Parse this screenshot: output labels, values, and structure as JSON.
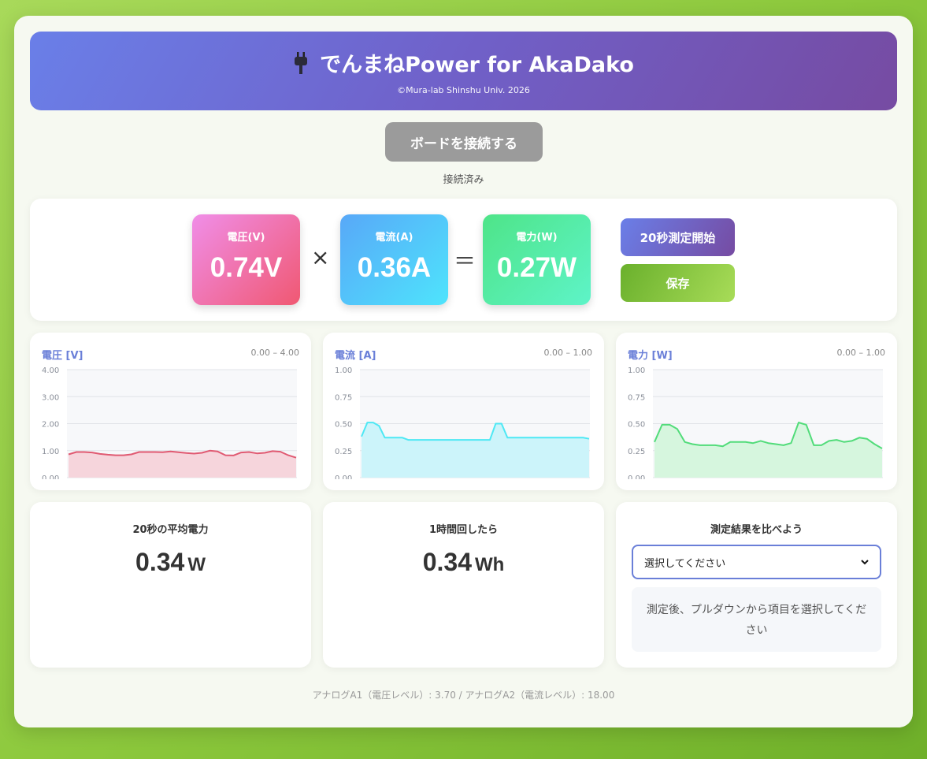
{
  "header": {
    "title": "でんまねPower for AkaDako",
    "subtitle": "©Mura-lab Shinshu Univ. 2026",
    "icon": "plug-icon"
  },
  "connection": {
    "button_label": "ボードを接続する",
    "status": "接続済み"
  },
  "meters": {
    "voltage": {
      "label": "電圧(V)",
      "value": "0.74V"
    },
    "current": {
      "label": "電流(A)",
      "value": "0.36A"
    },
    "power": {
      "label": "電力(W)",
      "value": "0.27W"
    },
    "times": "×",
    "equals": "＝"
  },
  "actions": {
    "start_label": "20秒測定開始",
    "save_label": "保存"
  },
  "charts": {
    "voltage": {
      "title": "電圧 [V]",
      "range": "0.00 – 4.00"
    },
    "current": {
      "title": "電流 [A]",
      "range": "0.00 – 1.00"
    },
    "power": {
      "title": "電力 [W]",
      "range": "0.00 – 1.00"
    }
  },
  "chart_data": [
    {
      "type": "area",
      "title": "電圧 [V]",
      "ylim": [
        0,
        4
      ],
      "yticks": [
        "0.00",
        "1.00",
        "2.00",
        "3.00",
        "4.00"
      ],
      "color": "#e05a72",
      "fill": "#f6d5dc",
      "values": [
        0.86,
        0.95,
        0.95,
        0.93,
        0.88,
        0.85,
        0.83,
        0.83,
        0.86,
        0.95,
        0.95,
        0.95,
        0.94,
        0.97,
        0.94,
        0.91,
        0.89,
        0.92,
        1.0,
        0.97,
        0.83,
        0.82,
        0.93,
        0.95,
        0.9,
        0.92,
        0.98,
        0.96,
        0.83,
        0.74
      ]
    },
    {
      "type": "area",
      "title": "電流 [A]",
      "ylim": [
        0,
        1
      ],
      "yticks": [
        "0.00",
        "0.25",
        "0.50",
        "0.75",
        "1.00"
      ],
      "color": "#4ee8f4",
      "fill": "#ccf4fa",
      "values": [
        0.38,
        0.51,
        0.51,
        0.48,
        0.37,
        0.37,
        0.37,
        0.37,
        0.35,
        0.35,
        0.35,
        0.35,
        0.35,
        0.35,
        0.35,
        0.35,
        0.35,
        0.35,
        0.35,
        0.35,
        0.35,
        0.35,
        0.35,
        0.5,
        0.5,
        0.37,
        0.37,
        0.37,
        0.37,
        0.37,
        0.37,
        0.37,
        0.37,
        0.37,
        0.37,
        0.37,
        0.37,
        0.37,
        0.37,
        0.36
      ]
    },
    {
      "type": "area",
      "title": "電力 [W]",
      "ylim": [
        0,
        1
      ],
      "yticks": [
        "0.00",
        "0.25",
        "0.50",
        "0.75",
        "1.00"
      ],
      "color": "#52dc7a",
      "fill": "#d6f6de",
      "values": [
        0.33,
        0.49,
        0.49,
        0.45,
        0.33,
        0.31,
        0.3,
        0.3,
        0.3,
        0.29,
        0.33,
        0.33,
        0.33,
        0.32,
        0.34,
        0.32,
        0.31,
        0.3,
        0.32,
        0.51,
        0.49,
        0.3,
        0.3,
        0.34,
        0.35,
        0.33,
        0.34,
        0.37,
        0.36,
        0.31,
        0.27
      ]
    }
  ],
  "stats": {
    "avg_power": {
      "label": "20秒の平均電力",
      "value": "0.34",
      "unit": "W"
    },
    "hourly": {
      "label": "1時間回したら",
      "value": "0.34",
      "unit": "Wh"
    },
    "compare": {
      "label": "測定結果を比べよう",
      "select_value": "選択してください",
      "hint": "測定後、プルダウンから項目を選択してください"
    }
  },
  "footer": {
    "text": "アナログA1（電圧レベル）: 3.70 / アナログA2（電流レベル）: 18.00"
  }
}
